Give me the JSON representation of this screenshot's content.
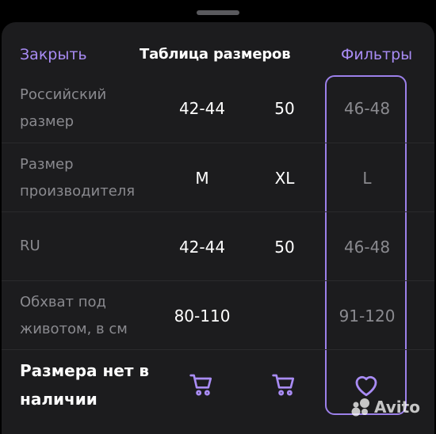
{
  "header": {
    "close_label": "Закрыть",
    "title": "Таблица размеров",
    "filters_label": "Фильтры"
  },
  "table": {
    "rows": [
      {
        "label": "Российский размер",
        "values": [
          "42-44",
          "50",
          "46-48"
        ]
      },
      {
        "label": "Размер производителя",
        "values": [
          "M",
          "XL",
          "L"
        ]
      },
      {
        "label": "RU",
        "values": [
          "42-44",
          "50",
          "46-48"
        ]
      },
      {
        "label": "Обхват под животом, в см",
        "values": [
          "80-110",
          "",
          "91-120"
        ]
      }
    ],
    "availability_label": "Размера нет в наличии",
    "availability_icons": [
      "cart-icon",
      "cart-icon",
      "heart-icon"
    ],
    "selected_column": 3
  },
  "watermark": "Avito",
  "colors": {
    "accent": "#a98cf5",
    "background": "#1c1c1e",
    "muted_text": "#8a8a8f"
  }
}
